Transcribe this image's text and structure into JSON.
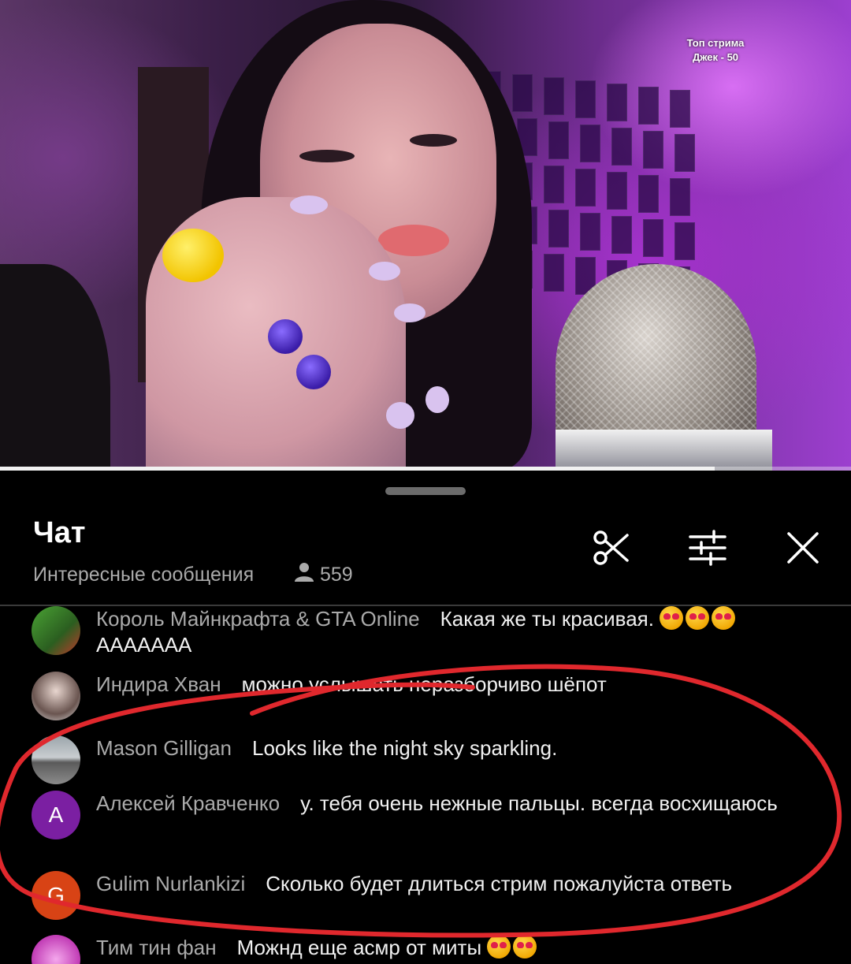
{
  "video": {
    "overlay_line1": "Топ стрима",
    "overlay_line2": "Джек - 50",
    "progress": 0.84
  },
  "chat": {
    "title": "Чат",
    "mode": "Интересные сообщения",
    "viewer_count": "559",
    "icons": [
      "scissors-icon",
      "sliders-icon",
      "close-icon",
      "person-icon"
    ]
  },
  "messages": [
    {
      "author": "Король Майнкрафта & GTA Online",
      "text": "Какая же ты красивая.",
      "emoji_count": 3,
      "continuation": "АААААAA",
      "avatar": "image",
      "avatar_color": "#3f7d2e"
    },
    {
      "author": "Индира Хван",
      "text": "можно услышать неразборчиво шёпот",
      "avatar": "image",
      "avatar_color": "#c9c4c2"
    },
    {
      "author": "Mason Gilligan",
      "text": "Looks like the night sky sparkling.",
      "avatar": "image",
      "avatar_color": "#8c8c8c"
    },
    {
      "author": "Алексей Кравченко",
      "text": "у. тебя очень нежные пальцы. всегда восхищаюсь",
      "avatar": "A",
      "avatar_color": "#7b1fa2"
    },
    {
      "author": "Gulim Nurlankizi",
      "text": "Сколько будет длиться стрим пожалуйста ответь",
      "avatar": "G",
      "avatar_color": "#d84315"
    },
    {
      "author": "Тим тин фан",
      "text": "Можнд еще асмр от миты",
      "avatar": "image",
      "avatar_color": "#d14fc4"
    }
  ],
  "annotation_color": "#e0282d"
}
